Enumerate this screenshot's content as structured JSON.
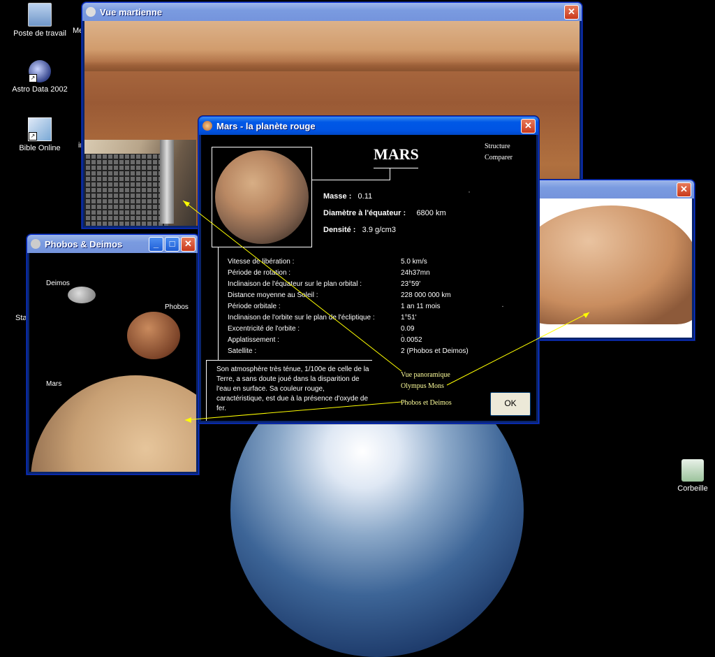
{
  "desktop": {
    "icons": [
      {
        "label": "Poste de travail",
        "icon": "computer-icon"
      },
      {
        "label": "Astro Data 2002",
        "icon": "astro-data-icon"
      },
      {
        "label": "Bible Online",
        "icon": "bible-online-icon"
      },
      {
        "label": "Corbeille",
        "icon": "recycle-bin-icon"
      }
    ],
    "cut_labels": [
      "Me",
      "in",
      "Sta"
    ]
  },
  "windows": {
    "vue_martienne": {
      "title": "Vue martienne",
      "close": "✕"
    },
    "olympus": {
      "close": "✕"
    },
    "phobos": {
      "title": "Phobos & Deimos",
      "minimize": "_",
      "maximize": "□",
      "close": "✕",
      "labels": {
        "deimos": "Deimos",
        "phobos": "Phobos",
        "mars": "Mars"
      }
    },
    "mars": {
      "title": "Mars - la planète rouge",
      "close": "✕",
      "heading": "MARS",
      "links": {
        "structure": "Structure",
        "comparer": "Comparer"
      },
      "main_props": [
        {
          "label": "Masse :",
          "value": "0.11"
        },
        {
          "label": "Diamètre à l'équateur :",
          "value": "6800 km"
        },
        {
          "label": "Densité :",
          "value": "3.9 g/cm3"
        }
      ],
      "details": [
        {
          "label": "Vitesse de libération :",
          "value": "5.0 km/s"
        },
        {
          "label": "Période de rotation :",
          "value": "24h37mn"
        },
        {
          "label": "Inclinaison de l'équateur sur le plan orbital :",
          "value": "23°59'"
        },
        {
          "label": "Distance moyenne au Soleil :",
          "value": "228 000 000 km"
        },
        {
          "label": "Période orbitale :",
          "value": "1 an 11 mois"
        },
        {
          "label": "Inclinaison de l'orbite sur le plan de l'écliptique :",
          "value": "1°51'"
        },
        {
          "label": "Excentricité de l'orbite :",
          "value": "0.09"
        },
        {
          "label": "Applatissement :",
          "value": "0.0052"
        },
        {
          "label": "Satellite :",
          "value": "2 (Phobos et Deimos)"
        }
      ],
      "description": "Son atmosphère très ténue, 1/100e de celle de la Terre, a sans doute joué dans la disparition de l'eau en surface. Sa couleur rouge, caractéristique, est due à la présence d'oxyde de fer.",
      "view_links": {
        "panoramique": "Vue panoramique",
        "olympus": "Olympus Mons",
        "phobos": "Phobos et Deimos"
      },
      "ok": "OK"
    }
  },
  "colors": {
    "titlebar": "#0054e3",
    "link": "#ffff9c",
    "arrow": "#ffff00",
    "desktop": "#000000"
  }
}
